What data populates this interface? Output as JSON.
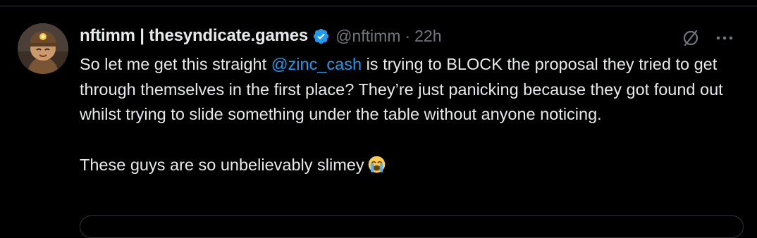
{
  "tweet": {
    "author": {
      "display_name": "nftimm | thesyndicate.games",
      "handle": "@nftimm",
      "verified": true
    },
    "separator": "·",
    "time": "22h",
    "body": {
      "line1_before": "So let me get this straight ",
      "mention": "@zinc_cash",
      "line1_after": " is trying to BLOCK the proposal they tried to get through themselves in the first place? They’re just panicking because they got found out whilst trying to slide something under the table without anyone noticing.",
      "para2": "These guys are so unbelievably slimey"
    },
    "emoji": "loudly-crying-face"
  },
  "colors": {
    "background": "#000000",
    "text": "#e7e9ea",
    "secondary": "#71767b",
    "accent": "#1d9bf0",
    "divider": "#2f3336"
  },
  "icons": {
    "verified": "verified-badge-icon",
    "grok": "grok-icon",
    "more": "more-horizontal-icon"
  }
}
